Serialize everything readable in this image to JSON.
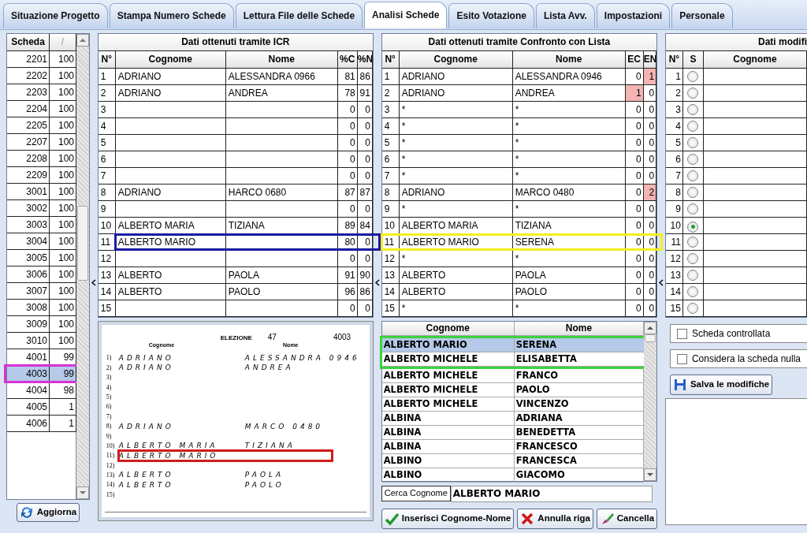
{
  "tabs": [
    {
      "label": "Situazione Progetto",
      "selected": false
    },
    {
      "label": "Stampa Numero Schede",
      "selected": false
    },
    {
      "label": "Lettura File delle Schede",
      "selected": false
    },
    {
      "label": "Analisi Schede",
      "selected": true
    },
    {
      "label": "Esito Votazione",
      "selected": false
    },
    {
      "label": "Lista Avv.",
      "selected": false
    },
    {
      "label": "Impostazioni",
      "selected": false
    },
    {
      "label": "Personale",
      "selected": false
    }
  ],
  "schede": {
    "columns": [
      "Scheda",
      "/"
    ],
    "rows": [
      {
        "number": "2201",
        "value": "100",
        "selected": false
      },
      {
        "number": "2202",
        "value": "100",
        "selected": false
      },
      {
        "number": "2203",
        "value": "100",
        "selected": false
      },
      {
        "number": "2204",
        "value": "100",
        "selected": false
      },
      {
        "number": "2205",
        "value": "100",
        "selected": false
      },
      {
        "number": "2207",
        "value": "100",
        "selected": false
      },
      {
        "number": "2208",
        "value": "100",
        "selected": false
      },
      {
        "number": "2209",
        "value": "100",
        "selected": false
      },
      {
        "number": "3001",
        "value": "100",
        "selected": false
      },
      {
        "number": "3002",
        "value": "100",
        "selected": false
      },
      {
        "number": "3003",
        "value": "100",
        "selected": false
      },
      {
        "number": "3004",
        "value": "100",
        "selected": false
      },
      {
        "number": "3005",
        "value": "100",
        "selected": false
      },
      {
        "number": "3006",
        "value": "100",
        "selected": false
      },
      {
        "number": "3007",
        "value": "100",
        "selected": false
      },
      {
        "number": "3008",
        "value": "100",
        "selected": false
      },
      {
        "number": "3009",
        "value": "100",
        "selected": false
      },
      {
        "number": "3010",
        "value": "100",
        "selected": false
      },
      {
        "number": "4001",
        "value": "99",
        "selected": false
      },
      {
        "number": "4003",
        "value": "99",
        "selected": true,
        "color": "#d633d6"
      },
      {
        "number": "4004",
        "value": "98",
        "selected": false
      },
      {
        "number": "4005",
        "value": "1",
        "selected": false
      },
      {
        "number": "4006",
        "value": "1",
        "selected": false
      }
    ],
    "button": "Aggiorna"
  },
  "icr": {
    "title": "Dati ottenuti tramite ICR",
    "columns": [
      "N°",
      "Cognome",
      "Nome",
      "%C",
      "%N"
    ],
    "rows": [
      {
        "n": "1",
        "cognome": "ADRIANO",
        "nome": "ALESSANDRA 0966",
        "pc": "81",
        "pn": "86"
      },
      {
        "n": "2",
        "cognome": "ADRIANO",
        "nome": "ANDREA",
        "pc": "78",
        "pn": "91"
      },
      {
        "n": "3",
        "pc": "0",
        "pn": "0"
      },
      {
        "n": "4",
        "pc": "0",
        "pn": "0"
      },
      {
        "n": "5",
        "pc": "0",
        "pn": "0"
      },
      {
        "n": "6",
        "pc": "0",
        "pn": "0"
      },
      {
        "n": "7",
        "pc": "0",
        "pn": "0"
      },
      {
        "n": "8",
        "cognome": "ADRIANO",
        "nome": "HARCO 0680",
        "pc": "87",
        "pn": "87"
      },
      {
        "n": "9",
        "pc": "0",
        "pn": "0"
      },
      {
        "n": "10",
        "cognome": "ALBERTO MARIA",
        "nome": "TIZIANA",
        "pc": "89",
        "pn": "84"
      },
      {
        "n": "11",
        "cognome": "ALBERTO MARIO",
        "pc": "80",
        "pn": "0",
        "color": "#1a1aa0"
      },
      {
        "n": "12",
        "pc": "0",
        "pn": "0"
      },
      {
        "n": "13",
        "cognome": "ALBERTO",
        "nome": "PAOLA",
        "pc": "91",
        "pn": "90"
      },
      {
        "n": "14",
        "cognome": "ALBERTO",
        "nome": "PAOLO",
        "pc": "96",
        "pn": "86"
      },
      {
        "n": "15",
        "pc": "0",
        "pn": "0"
      }
    ]
  },
  "scan": {
    "label": "ELEZIONE",
    "number": "47",
    "scheda": "4003",
    "columns": [
      "Cognome",
      "Nome"
    ],
    "lines": [
      {
        "n": "1)",
        "cognome": "ADRIANO",
        "nome": "ALESSANDRA 0946"
      },
      {
        "n": "2)",
        "cognome": "ADRIANO",
        "nome": "ANDREA"
      },
      {
        "n": "3)"
      },
      {
        "n": "4)"
      },
      {
        "n": "5)"
      },
      {
        "n": "6)"
      },
      {
        "n": "7)"
      },
      {
        "n": "8)",
        "cognome": "ADRIANO",
        "nome": "MARCO 0480"
      },
      {
        "n": "9)"
      },
      {
        "n": "10)",
        "cognome": "ALBERTO MARIA",
        "nome": "TIZIANA"
      },
      {
        "n": "11)",
        "cognome": "ALBERTO MARIO",
        "color": "#d01c1c"
      },
      {
        "n": "12)"
      },
      {
        "n": "13)",
        "cognome": "ALBERTO",
        "nome": "PAOLA"
      },
      {
        "n": "14)",
        "cognome": "ALBERTO",
        "nome": "PAOLO"
      },
      {
        "n": "15)"
      }
    ]
  },
  "lista": {
    "title": "Dati ottenuti tramite Confronto con Lista",
    "columns": [
      "N°",
      "Cognome",
      "Nome",
      "EC",
      "EN"
    ],
    "rows": [
      {
        "n": "1",
        "cognome": "ADRIANO",
        "nome": "ALESSANDRA 0946",
        "ec": "0",
        "en": "1",
        "ec_alert": false,
        "en_alert": true
      },
      {
        "n": "2",
        "cognome": "ADRIANO",
        "nome": "ANDREA",
        "ec": "1",
        "en": "0",
        "ec_alert": true,
        "en_alert": false
      },
      {
        "n": "3",
        "cognome": "*",
        "nome": "*",
        "ec": "0",
        "en": "0",
        "ec_alert": false,
        "en_alert": false
      },
      {
        "n": "4",
        "cognome": "*",
        "nome": "*",
        "ec": "0",
        "en": "0",
        "ec_alert": false,
        "en_alert": false
      },
      {
        "n": "5",
        "cognome": "*",
        "nome": "*",
        "ec": "0",
        "en": "0",
        "ec_alert": false,
        "en_alert": false
      },
      {
        "n": "6",
        "cognome": "*",
        "nome": "*",
        "ec": "0",
        "en": "0",
        "ec_alert": false,
        "en_alert": false
      },
      {
        "n": "7",
        "cognome": "*",
        "nome": "*",
        "ec": "0",
        "en": "0",
        "ec_alert": false,
        "en_alert": false
      },
      {
        "n": "8",
        "cognome": "ADRIANO",
        "nome": "MARCO 0480",
        "ec": "0",
        "en": "2",
        "ec_alert": false,
        "en_alert": true
      },
      {
        "n": "9",
        "cognome": "*",
        "nome": "*",
        "ec": "0",
        "en": "0",
        "ec_alert": false,
        "en_alert": false
      },
      {
        "n": "10",
        "cognome": "ALBERTO MARIA",
        "nome": "TIZIANA",
        "ec": "0",
        "en": "0",
        "ec_alert": false,
        "en_alert": false
      },
      {
        "n": "11",
        "cognome": "ALBERTO MARIO",
        "nome": "SERENA",
        "ec": "0",
        "en": "0",
        "ec_alert": false,
        "en_alert": false,
        "color": "#f0f020"
      },
      {
        "n": "12",
        "cognome": "*",
        "nome": "*",
        "ec": "0",
        "en": "0",
        "ec_alert": false,
        "en_alert": false
      },
      {
        "n": "13",
        "cognome": "ALBERTO",
        "nome": "PAOLA",
        "ec": "0",
        "en": "0",
        "ec_alert": false,
        "en_alert": false
      },
      {
        "n": "14",
        "cognome": "ALBERTO",
        "nome": "PAOLO",
        "ec": "0",
        "en": "0",
        "ec_alert": false,
        "en_alert": false
      },
      {
        "n": "15",
        "cognome": "*",
        "nome": "*",
        "ec": "0",
        "en": "0",
        "ec_alert": false,
        "en_alert": false
      }
    ]
  },
  "lookup": {
    "columns": [
      "Cognome",
      "Nome"
    ],
    "rows": [
      {
        "cognome": "ALBERTO MARIO",
        "nome": "SERENA",
        "selected": true,
        "color": "#3cd23c"
      },
      {
        "cognome": "ALBERTO MICHELE",
        "nome": "ELISABETTA",
        "selected": false
      },
      {
        "cognome": "ALBERTO MICHELE",
        "nome": "FRANCO",
        "selected": false
      },
      {
        "cognome": "ALBERTO MICHELE",
        "nome": "PAOLO",
        "selected": false
      },
      {
        "cognome": "ALBERTO MICHELE",
        "nome": "VINCENZO",
        "selected": false
      },
      {
        "cognome": "ALBINA",
        "nome": "ADRIANA",
        "selected": false
      },
      {
        "cognome": "ALBINA",
        "nome": "BENEDETTA",
        "selected": false
      },
      {
        "cognome": "ALBINA",
        "nome": "FRANCESCO",
        "selected": false
      },
      {
        "cognome": "ALBINO",
        "nome": "FRANCESCA",
        "selected": false
      },
      {
        "cognome": "ALBINO",
        "nome": "GIACOMO",
        "selected": false
      }
    ],
    "search_label": "Cerca Cognome",
    "search_value": "ALBERTO MARIO",
    "buttons": [
      {
        "label": "Inserisci Cognome-Nome",
        "kind": "confirm"
      },
      {
        "label": "Annulla riga",
        "kind": "cancel"
      },
      {
        "label": "Cancella",
        "kind": "clear"
      }
    ]
  },
  "modifiche": {
    "title": "Dati modifi",
    "columns": [
      "N°",
      "S",
      "Cognome"
    ],
    "rows": [
      {
        "n": "1",
        "selected": false
      },
      {
        "n": "2",
        "selected": false
      },
      {
        "n": "3",
        "selected": false
      },
      {
        "n": "4",
        "selected": false
      },
      {
        "n": "5",
        "selected": false
      },
      {
        "n": "6",
        "selected": false
      },
      {
        "n": "7",
        "selected": false
      },
      {
        "n": "8",
        "selected": false
      },
      {
        "n": "9",
        "selected": false
      },
      {
        "n": "10",
        "selected": true
      },
      {
        "n": "11",
        "selected": false
      },
      {
        "n": "12",
        "selected": false
      },
      {
        "n": "13",
        "selected": false
      },
      {
        "n": "14",
        "selected": false
      },
      {
        "n": "15",
        "selected": false
      }
    ],
    "checks": [
      {
        "label": "Scheda controllata",
        "checked": false
      },
      {
        "label": "Considera la scheda nulla",
        "checked": false
      }
    ],
    "save_button": "Salva le modifiche"
  }
}
